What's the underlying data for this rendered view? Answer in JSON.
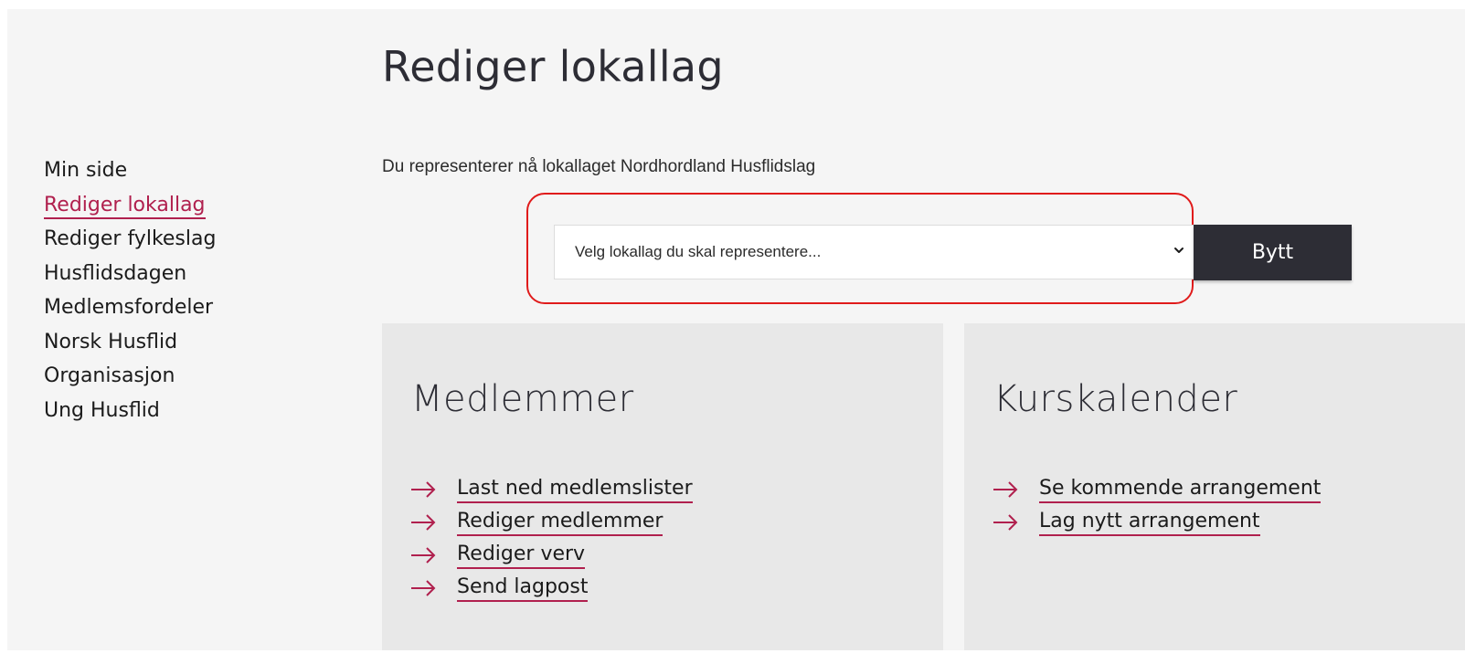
{
  "page": {
    "title": "Rediger lokallag"
  },
  "sidebar": {
    "items": [
      {
        "label": "Min side",
        "active": false
      },
      {
        "label": "Rediger lokallag",
        "active": true
      },
      {
        "label": "Rediger fylkeslag",
        "active": false
      },
      {
        "label": "Husflidsdagen",
        "active": false
      },
      {
        "label": "Medlemsfordeler",
        "active": false
      },
      {
        "label": "Norsk Husflid",
        "active": false
      },
      {
        "label": "Organisasjon",
        "active": false
      },
      {
        "label": "Ung Husflid",
        "active": false
      }
    ]
  },
  "representation": {
    "info_text": "Du representerer nå lokallaget Nordhordland Husflidslag",
    "select_value": "Velg lokallag du skal representere...",
    "button_label": "Bytt"
  },
  "cards": {
    "members": {
      "title": "Medlemmer",
      "links": [
        {
          "label": "Last ned medlemslister"
        },
        {
          "label": "Rediger medlemmer"
        },
        {
          "label": "Rediger verv"
        },
        {
          "label": "Send lagpost"
        }
      ]
    },
    "courses": {
      "title": "Kurskalender",
      "links": [
        {
          "label": "Se kommende arrangement"
        },
        {
          "label": "Lag nytt arrangement"
        }
      ]
    }
  },
  "colors": {
    "accent": "#b0204e",
    "dark": "#2d2d35",
    "highlight": "#e01b1b",
    "card_background": "#e8e8e8",
    "page_background": "#f5f5f5"
  }
}
